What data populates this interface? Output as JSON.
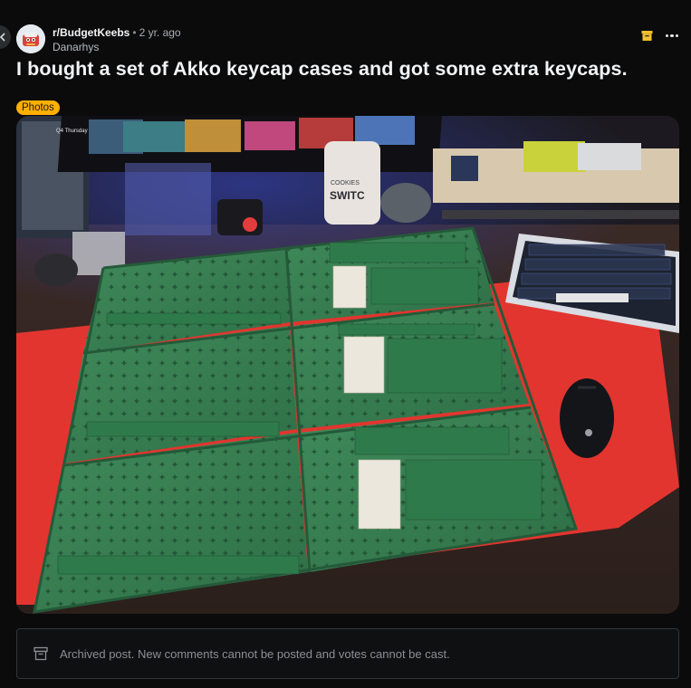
{
  "post": {
    "subreddit": "r/BudgetKeebs",
    "separator": "•",
    "age": "2 yr. ago",
    "author": "Danarhys",
    "title": "I bought a set of Akko keycap cases and got some extra keycaps.",
    "flair": "Photos"
  },
  "photo_text": {
    "monitor_date": "Q4 Thursday",
    "jar_label": "SWITC",
    "jar_top_text": "COOKIES"
  },
  "archived_notice": "Archived post. New comments cannot be posted and votes cannot be cast.",
  "colors": {
    "flair_bg": "#ffb000",
    "case_green": "#3f8a5a",
    "desk_mat_red": "#e2352f"
  },
  "icons": {
    "back": "chevron-left-icon",
    "archive": "archive-box-icon",
    "more": "ellipsis-icon"
  }
}
